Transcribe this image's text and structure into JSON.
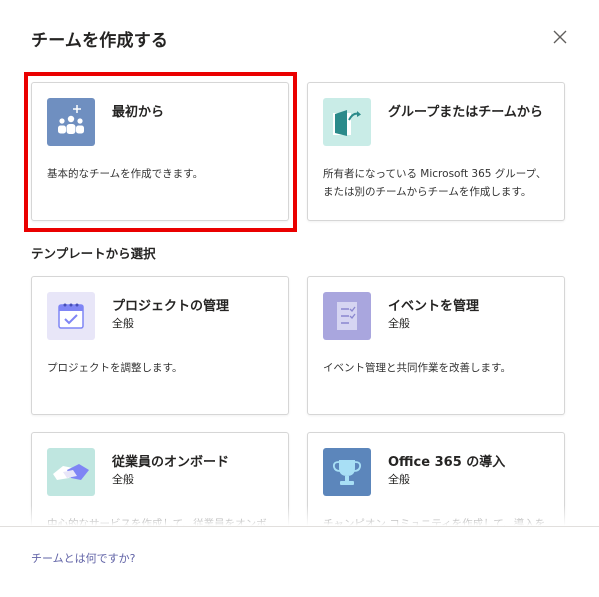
{
  "dialog": {
    "title": "チームを作成する",
    "close_icon": "close-icon"
  },
  "create_options": [
    {
      "title": "最初から",
      "description": "基本的なチームを作成できます。",
      "icon": "team-add-icon",
      "icon_bg": "#6f8fc0",
      "selected": true
    },
    {
      "title": "グループまたはチームから",
      "description": "所有者になっている Microsoft 365 グループ、または別のチームからチームを作成します。",
      "icon": "group-export-icon",
      "icon_bg": "#c9ece7"
    }
  ],
  "templates_section": {
    "heading": "テンプレートから選択",
    "items": [
      {
        "title": "プロジェクトの管理",
        "subtitle": "全般",
        "description": "プロジェクトを調整します。",
        "icon": "calendar-check-icon",
        "icon_bg": "#e8e6f8"
      },
      {
        "title": "イベントを管理",
        "subtitle": "全般",
        "description": "イベント管理と共同作業を改善します。",
        "icon": "checklist-icon",
        "icon_bg": "#a9a6de"
      },
      {
        "title": "従業員のオンボード",
        "subtitle": "全般",
        "description": "中心的なサービスを作成して、従業員をオンボード",
        "icon": "handshake-icon",
        "icon_bg": "#bfe6e0"
      },
      {
        "title": "Office 365 の導入",
        "subtitle": "全般",
        "description": "チャンピオン コミュニティを作成して、導入を推進し",
        "icon": "trophy-icon",
        "icon_bg": "#5c86bb"
      }
    ]
  },
  "footer": {
    "help_link": "チームとは何ですか?"
  },
  "colors": {
    "highlight": "#ea0000",
    "link": "#6264a7"
  }
}
